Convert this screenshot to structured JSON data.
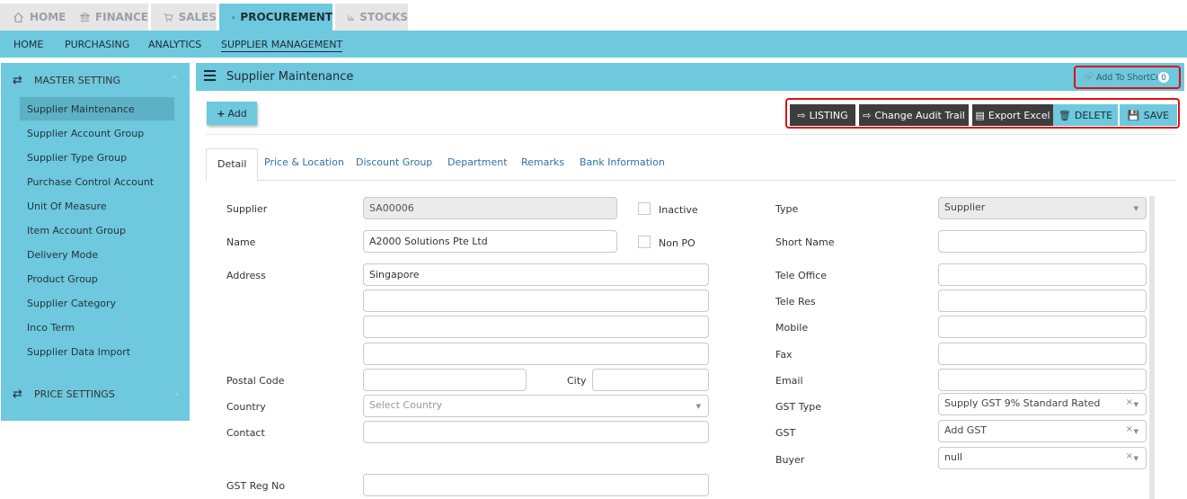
{
  "module_tabs": [
    {
      "label": "HOME",
      "icon": "home-icon"
    },
    {
      "label": "FINANCE",
      "icon": "bank-icon"
    },
    {
      "label": "SALES",
      "icon": "cart-icon"
    },
    {
      "label": "PROCUREMENT",
      "icon": "megaphone-icon"
    },
    {
      "label": "STOCKS",
      "icon": "bar-chart-icon"
    }
  ],
  "active_module": "PROCUREMENT",
  "subnav": [
    "HOME",
    "PURCHASING",
    "ANALYTICS",
    "SUPPLIER MANAGEMENT"
  ],
  "active_subnav": "SUPPLIER MANAGEMENT",
  "sidebar": {
    "section1": "MASTER SETTING",
    "items": [
      "Supplier Maintenance",
      "Supplier Account Group",
      "Supplier Type Group",
      "Purchase Control Account",
      "Unit Of Measure",
      "Item Account Group",
      "Delivery Mode",
      "Product Group",
      "Supplier Category",
      "Inco Term",
      "Supplier Data Import"
    ],
    "active_item": "Supplier Maintenance",
    "section2": "PRICE SETTINGS"
  },
  "page": {
    "title": "Supplier Maintenance",
    "shortcut_label": "Add To ShortCut",
    "shortcut_count": "0"
  },
  "actions": {
    "add": "Add",
    "listing": "LISTING",
    "audit": "Change Audit Trail",
    "export": "Export Excel",
    "delete": "DELETE",
    "save": "SAVE"
  },
  "tabs": [
    "Detail",
    "Price & Location",
    "Discount Group",
    "Department",
    "Remarks",
    "Bank Information"
  ],
  "active_tab": "Detail",
  "form": {
    "supplier_label": "Supplier",
    "supplier_value": "SA00006",
    "inactive_label": "Inactive",
    "name_label": "Name",
    "name_value": "A2000 Solutions Pte Ltd",
    "nonpo_label": "Non PO",
    "address_label": "Address",
    "address_lines": [
      "Singapore",
      "",
      "",
      ""
    ],
    "postal_label": "Postal Code",
    "city_label": "City",
    "country_label": "Country",
    "country_placeholder": "Select Country",
    "contact_label": "Contact",
    "gstreg_label": "GST Reg No",
    "type_label": "Type",
    "type_value": "Supplier",
    "shortname_label": "Short Name",
    "teleoffice_label": "Tele Office",
    "teleres_label": "Tele Res",
    "mobile_label": "Mobile",
    "fax_label": "Fax",
    "email_label": "Email",
    "gsttype_label": "GST Type",
    "gsttype_value": "Supply GST 9% Standard Rated",
    "gst_label": "GST",
    "gst_value": "Add GST",
    "buyer_label": "Buyer",
    "buyer_value": "null"
  }
}
